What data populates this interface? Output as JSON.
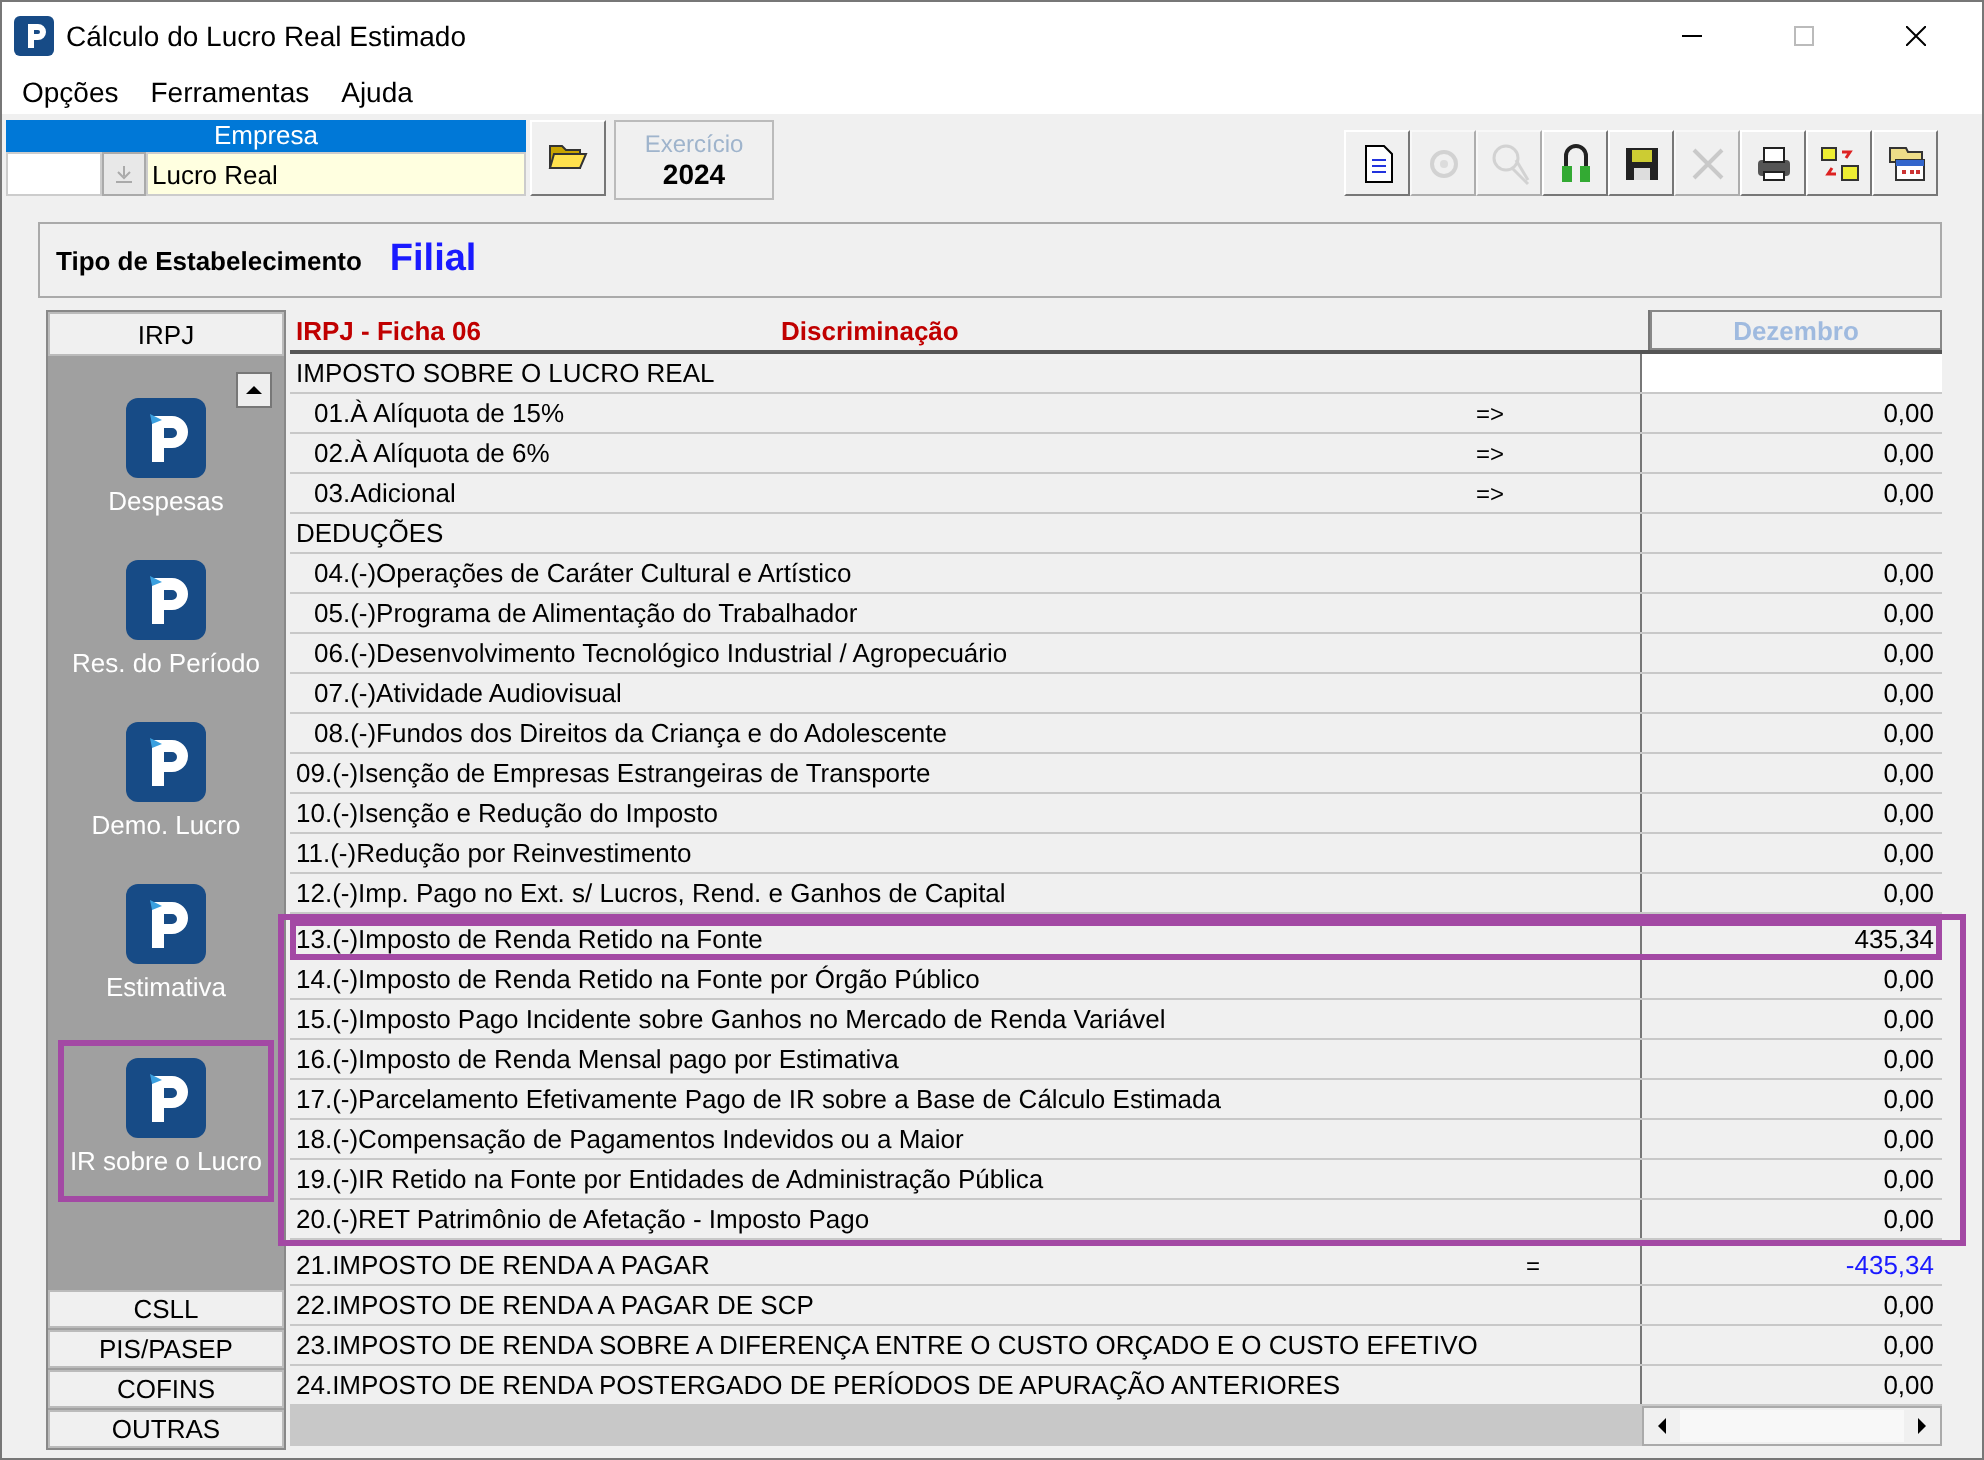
{
  "window": {
    "title": "Cálculo do Lucro Real Estimado"
  },
  "menu": [
    "Opções",
    "Ferramentas",
    "Ajuda"
  ],
  "company": {
    "header": "Empresa",
    "name": "Lucro Real"
  },
  "fiscal_year": {
    "label": "Exercício",
    "value": "2024"
  },
  "toolbar": [
    {
      "kind": "document",
      "disabled": false
    },
    {
      "kind": "gear",
      "disabled": true
    },
    {
      "kind": "magnifier",
      "disabled": true
    },
    {
      "kind": "lock",
      "disabled": false
    },
    {
      "kind": "save",
      "disabled": false
    },
    {
      "kind": "delete",
      "disabled": true
    },
    {
      "kind": "print",
      "disabled": false
    },
    {
      "kind": "folders",
      "disabled": false
    },
    {
      "kind": "window",
      "disabled": false
    }
  ],
  "establishment": {
    "label": "Tipo de Estabelecimento",
    "value": "Filial"
  },
  "sidebar": {
    "top_tab": "IRPJ",
    "items": [
      {
        "label": "Despesas",
        "framed": false
      },
      {
        "label": "Res. do Período",
        "framed": false
      },
      {
        "label": "Demo. Lucro",
        "framed": false
      },
      {
        "label": "Estimativa",
        "framed": false
      },
      {
        "label": "IR sobre o Lucro",
        "framed": true
      }
    ],
    "bottom_tabs": [
      "CSLL",
      "PIS/PASEP",
      "COFINS",
      "OUTRAS"
    ]
  },
  "table": {
    "title": "IRPJ - Ficha 06",
    "column_header": "Discriminação",
    "value_header": "Dezembro",
    "blocks": [
      {
        "framed": false,
        "rows": [
          {
            "kind": "section",
            "text": "IMPOSTO SOBRE O LUCRO REAL",
            "framed": false
          },
          {
            "kind": "subitem",
            "text": "01.À Alíquota de 15%",
            "mark": "=>",
            "value": "0,00",
            "framed": false
          },
          {
            "kind": "subitem",
            "text": "02.À Alíquota de 6%",
            "mark": "=>",
            "value": "0,00",
            "framed": false
          },
          {
            "kind": "subitem",
            "text": "03.Adicional",
            "mark": "=>",
            "value": "0,00",
            "framed": false
          },
          {
            "kind": "section",
            "text": "DEDUÇÕES",
            "framed": false
          },
          {
            "kind": "subitem",
            "text": "04.(-)Operações de Caráter Cultural e Artístico",
            "value": "0,00",
            "framed": false
          },
          {
            "kind": "subitem",
            "text": "05.(-)Programa de Alimentação do Trabalhador",
            "value": "0,00",
            "framed": false
          },
          {
            "kind": "subitem",
            "text": "06.(-)Desenvolvimento Tecnológico Industrial / Agropecuário",
            "value": "0,00",
            "framed": false
          },
          {
            "kind": "subitem",
            "text": "07.(-)Atividade Audiovisual",
            "value": "0,00",
            "framed": false
          },
          {
            "kind": "subitem",
            "text": "08.(-)Fundos dos Direitos da Criança e  do Adolescente",
            "value": "0,00",
            "framed": false
          },
          {
            "kind": "item",
            "text": "09.(-)Isenção de Empresas Estrangeiras de Transporte",
            "value": "0,00",
            "framed": false
          },
          {
            "kind": "item",
            "text": "10.(-)Isenção e Redução do Imposto",
            "value": "0,00",
            "framed": false
          },
          {
            "kind": "item",
            "text": "11.(-)Redução por Reinvestimento",
            "value": "0,00",
            "framed": false
          },
          {
            "kind": "item",
            "text": "12.(-)Imp. Pago no Ext. s/ Lucros, Rend. e Ganhos de Capital",
            "value": "0,00",
            "framed": false
          }
        ]
      },
      {
        "framed": true,
        "rows": [
          {
            "kind": "item",
            "text": "13.(-)Imposto de Renda Retido na Fonte",
            "value": "435,34",
            "framed": true
          },
          {
            "kind": "item",
            "text": "14.(-)Imposto de Renda Retido na Fonte por Órgão Público",
            "value": "0,00",
            "framed": false
          },
          {
            "kind": "item",
            "text": "15.(-)Imposto Pago Incidente sobre Ganhos no Mercado de Renda Variável",
            "value": "0,00",
            "framed": false
          },
          {
            "kind": "item",
            "text": "16.(-)Imposto de Renda Mensal pago por Estimativa",
            "value": "0,00",
            "framed": false
          },
          {
            "kind": "item",
            "text": "17.(-)Parcelamento Efetivamente Pago de IR sobre a Base de Cálculo Estimada",
            "value": "0,00",
            "framed": false
          },
          {
            "kind": "item",
            "text": "18.(-)Compensação de Pagamentos Indevidos ou a Maior",
            "value": "0,00",
            "framed": false
          },
          {
            "kind": "item",
            "text": "19.(-)IR Retido na Fonte por Entidades de Administração Pública",
            "value": "0,00",
            "framed": false
          },
          {
            "kind": "item",
            "text": "20.(-)RET Patrimônio de Afetação - Imposto Pago",
            "value": "0,00",
            "framed": false
          }
        ]
      },
      {
        "framed": false,
        "rows": [
          {
            "kind": "result",
            "text": "21.IMPOSTO DE RENDA A PAGAR",
            "mark": "=",
            "value": "-435,34",
            "framed": false
          },
          {
            "kind": "item",
            "text": "22.IMPOSTO DE RENDA A PAGAR DE SCP",
            "value": "0,00",
            "framed": false
          },
          {
            "kind": "item",
            "text": "23.IMPOSTO DE RENDA SOBRE A DIFERENÇA ENTRE O CUSTO ORÇADO E O CUSTO EFETIVO",
            "value": "0,00",
            "framed": false
          },
          {
            "kind": "item",
            "text": "24.IMPOSTO DE RENDA POSTERGADO DE PERÍODOS DE APURAÇÃO ANTERIORES",
            "value": "0,00",
            "framed": false
          }
        ]
      }
    ]
  }
}
